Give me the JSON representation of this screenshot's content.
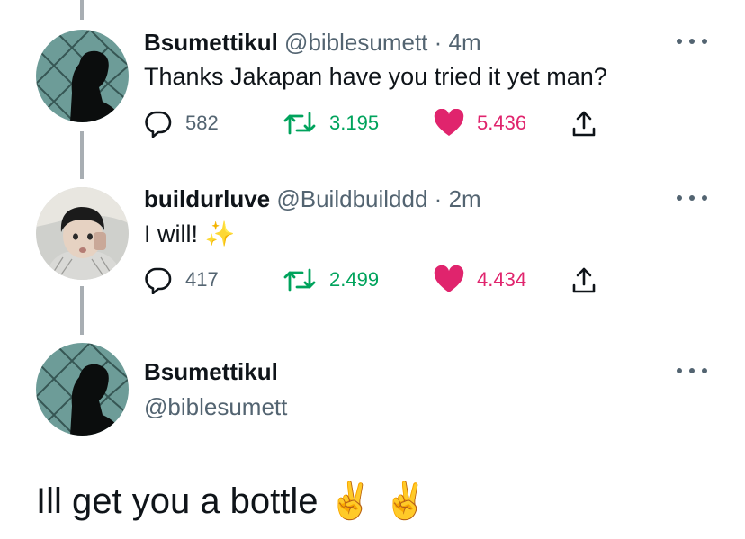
{
  "tweets": [
    {
      "name": "Bsumettikul",
      "handle": "@biblesumett",
      "separator": "·",
      "time": "4m",
      "text": "Thanks Jakapan have you tried it yet man?",
      "replies": "582",
      "retweets": "3.195",
      "likes": "5.436"
    },
    {
      "name": "buildurluve",
      "handle": "@Buildbuilddd",
      "separator": "·",
      "time": "2m",
      "text": "I will!",
      "emoji": "✨",
      "replies": "417",
      "retweets": "2.499",
      "likes": "4.434"
    }
  ],
  "main_tweet": {
    "name": "Bsumettikul",
    "handle": "@biblesumett",
    "text": "Ill get you a bottle",
    "emoji_1": "✌️",
    "emoji_2": "✌️"
  },
  "colors": {
    "text": "#0f1419",
    "secondary": "#536471",
    "retweet": "#00a35c",
    "like": "#e0246d",
    "thread_line": "#a8aeb3"
  },
  "icons": [
    "reply-icon",
    "retweet-icon",
    "heart-icon",
    "share-icon",
    "more-icon"
  ]
}
